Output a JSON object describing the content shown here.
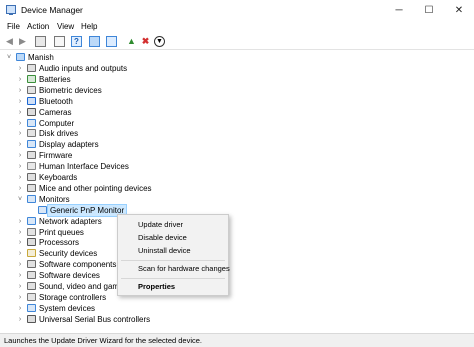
{
  "window": {
    "title": "Device Manager",
    "controls": {
      "minimize": "─",
      "maximize": "☐",
      "close": "✕"
    }
  },
  "menu": [
    "File",
    "Action",
    "View",
    "Help"
  ],
  "toolbar": [
    "back-icon",
    "forward-icon",
    "device-view-icon",
    "properties-icon",
    "help-icon",
    "display-icon",
    "scan-hardware-icon",
    "update-driver-icon",
    "uninstall-icon",
    "disable-icon"
  ],
  "tree": {
    "root": "Manish",
    "items": [
      {
        "label": "Audio inputs and outputs",
        "icon": "speaker-icon",
        "color": "#6a6a6a"
      },
      {
        "label": "Batteries",
        "icon": "battery-icon",
        "color": "#3a8f3a"
      },
      {
        "label": "Biometric devices",
        "icon": "biometric-icon",
        "color": "#6d6d6d"
      },
      {
        "label": "Bluetooth",
        "icon": "bluetooth-icon",
        "color": "#1a66d2"
      },
      {
        "label": "Cameras",
        "icon": "camera-icon",
        "color": "#555555"
      },
      {
        "label": "Computer",
        "icon": "computer-icon",
        "color": "#3f86d8"
      },
      {
        "label": "Disk drives",
        "icon": "disk-icon",
        "color": "#777777"
      },
      {
        "label": "Display adapters",
        "icon": "display-adapter-icon",
        "color": "#3f86d8"
      },
      {
        "label": "Firmware",
        "icon": "firmware-icon",
        "color": "#6a6a6a"
      },
      {
        "label": "Human Interface Devices",
        "icon": "hid-icon",
        "color": "#8a8a8a"
      },
      {
        "label": "Keyboards",
        "icon": "keyboard-icon",
        "color": "#666666"
      },
      {
        "label": "Mice and other pointing devices",
        "icon": "mouse-icon",
        "color": "#666666"
      },
      {
        "label": "Monitors",
        "icon": "monitor-icon",
        "color": "#3f86d8",
        "expanded": true
      },
      {
        "label": "Generic PnP Monitor",
        "icon": "monitor-icon",
        "color": "#3f86d8",
        "child": true,
        "selected": true
      },
      {
        "label": "Network adapters",
        "icon": "network-icon",
        "color": "#3f86d8"
      },
      {
        "label": "Print queues",
        "icon": "printer-icon",
        "color": "#777777"
      },
      {
        "label": "Processors",
        "icon": "processor-icon",
        "color": "#555555"
      },
      {
        "label": "Security devices",
        "icon": "security-icon",
        "color": "#c8a83a"
      },
      {
        "label": "Software components",
        "icon": "software-component-icon",
        "color": "#6a6a6a"
      },
      {
        "label": "Software devices",
        "icon": "software-device-icon",
        "color": "#6a6a6a"
      },
      {
        "label": "Sound, video and game controllers",
        "icon": "sound-icon",
        "color": "#6a6a6a"
      },
      {
        "label": "Storage controllers",
        "icon": "storage-icon",
        "color": "#777777"
      },
      {
        "label": "System devices",
        "icon": "system-device-icon",
        "color": "#3f86d8"
      },
      {
        "label": "Universal Serial Bus controllers",
        "icon": "usb-icon",
        "color": "#555555"
      }
    ]
  },
  "context_menu": [
    "Update driver",
    "Disable device",
    "Uninstall device",
    "Scan for hardware changes",
    "Properties"
  ],
  "status": "Launches the Update Driver Wizard for the selected device.",
  "colors": {
    "selection": "#cce8ff",
    "accent": "#3f86d8",
    "uninstall": "#d32f2f"
  }
}
